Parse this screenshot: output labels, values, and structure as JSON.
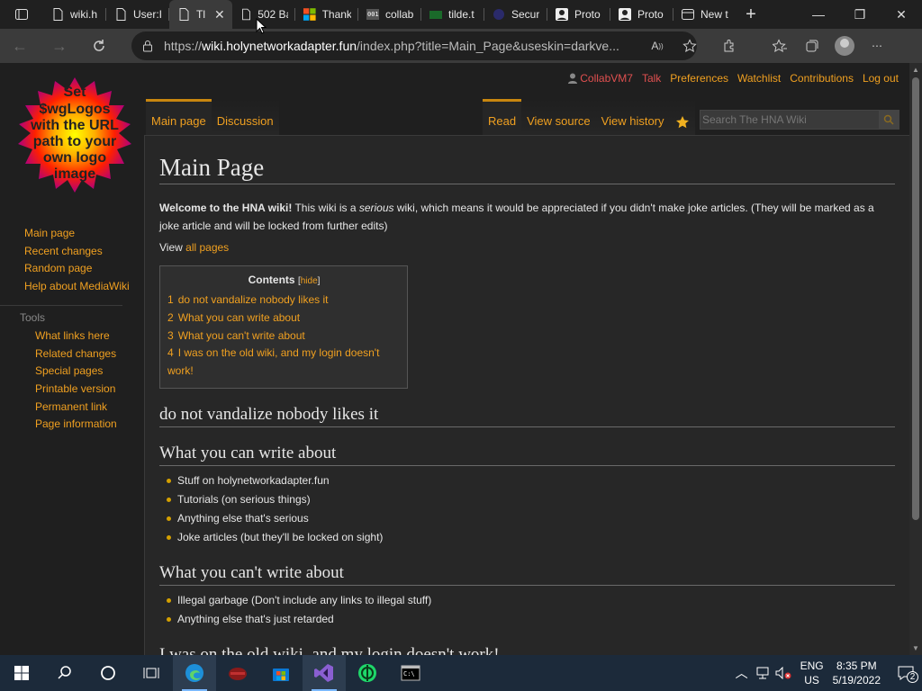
{
  "browser": {
    "tabs": [
      {
        "label": "wiki.h",
        "icon": "page-icon",
        "active": false
      },
      {
        "label": "User:I",
        "icon": "page-icon",
        "active": false
      },
      {
        "label": "Tl",
        "icon": "page-icon",
        "active": true
      },
      {
        "label": "502 Ba",
        "icon": "page-icon",
        "active": false
      },
      {
        "label": "Thank",
        "icon": "microsoft-logo-icon",
        "active": false
      },
      {
        "label": "collab",
        "icon": "collab-icon",
        "active": false
      },
      {
        "label": "tilde.t",
        "icon": "tilde-icon",
        "active": false
      },
      {
        "label": "Secur",
        "icon": "secure-icon",
        "active": false
      },
      {
        "label": "Proto",
        "icon": "profile-icon",
        "active": false
      },
      {
        "label": "Proto",
        "icon": "profile-icon",
        "active": false
      },
      {
        "label": "New t",
        "icon": "newtab-icon",
        "active": false
      }
    ],
    "url_prefix": "https://",
    "url_host": "wiki.holynetworkadapter.fun",
    "url_path": "/index.php?title=Main_Page&useskin=darkve..."
  },
  "wiki": {
    "logo_text": [
      "Set",
      "$wgLogos",
      "with the URL",
      "path to your",
      "own logo",
      "image"
    ],
    "personal": {
      "user": "CollabVM7",
      "talk": "Talk",
      "preferences": "Preferences",
      "watchlist": "Watchlist",
      "contributions": "Contributions",
      "logout": "Log out"
    },
    "tabs_left": {
      "main": "Main page",
      "discussion": "Discussion"
    },
    "tabs_right": {
      "read": "Read",
      "view_source": "View source",
      "view_history": "View history"
    },
    "search_placeholder": "Search The HNA Wiki",
    "sidebar": {
      "nav": [
        "Main page",
        "Recent changes",
        "Random page",
        "Help about MediaWiki"
      ],
      "tools_heading": "Tools",
      "tools": [
        "What links here",
        "Related changes",
        "Special pages",
        "Printable version",
        "Permanent link",
        "Page information"
      ]
    },
    "page_title": "Main Page",
    "intro_bold": "Welcome to the HNA wiki!",
    "intro_1": " This wiki is a ",
    "intro_em": "serious",
    "intro_2": " wiki, which means it would be appreciated if you didn't make joke articles. (They will be marked as a joke article and will be locked from further edits)",
    "view_prefix": "View ",
    "all_pages": "all pages",
    "toc": {
      "title": "Contents",
      "hide": "hide",
      "entries": [
        {
          "num": "1",
          "text": "do not vandalize nobody likes it"
        },
        {
          "num": "2",
          "text": "What you can write about"
        },
        {
          "num": "3",
          "text": "What you can't write about"
        },
        {
          "num": "4",
          "text": "I was on the old wiki, and my login doesn't work!"
        }
      ]
    },
    "sections": {
      "s1": "do not vandalize nobody likes it",
      "s2": "What you can write about",
      "s2_items": [
        "Stuff on holynetworkadapter.fun",
        "Tutorials (on serious things)",
        "Anything else that's serious",
        "Joke articles (but they'll be locked on sight)"
      ],
      "s3": "What you can't write about",
      "s3_items": [
        "Illegal garbage (Don't include any links to illegal stuff)",
        "Anything else that's just retarded"
      ],
      "s4": "I was on the old wiki, and my login doesn't work!"
    }
  },
  "taskbar": {
    "lang_1": "ENG",
    "lang_2": "US",
    "time": "8:35 PM",
    "date": "5/19/2022",
    "notif_count": "2"
  }
}
